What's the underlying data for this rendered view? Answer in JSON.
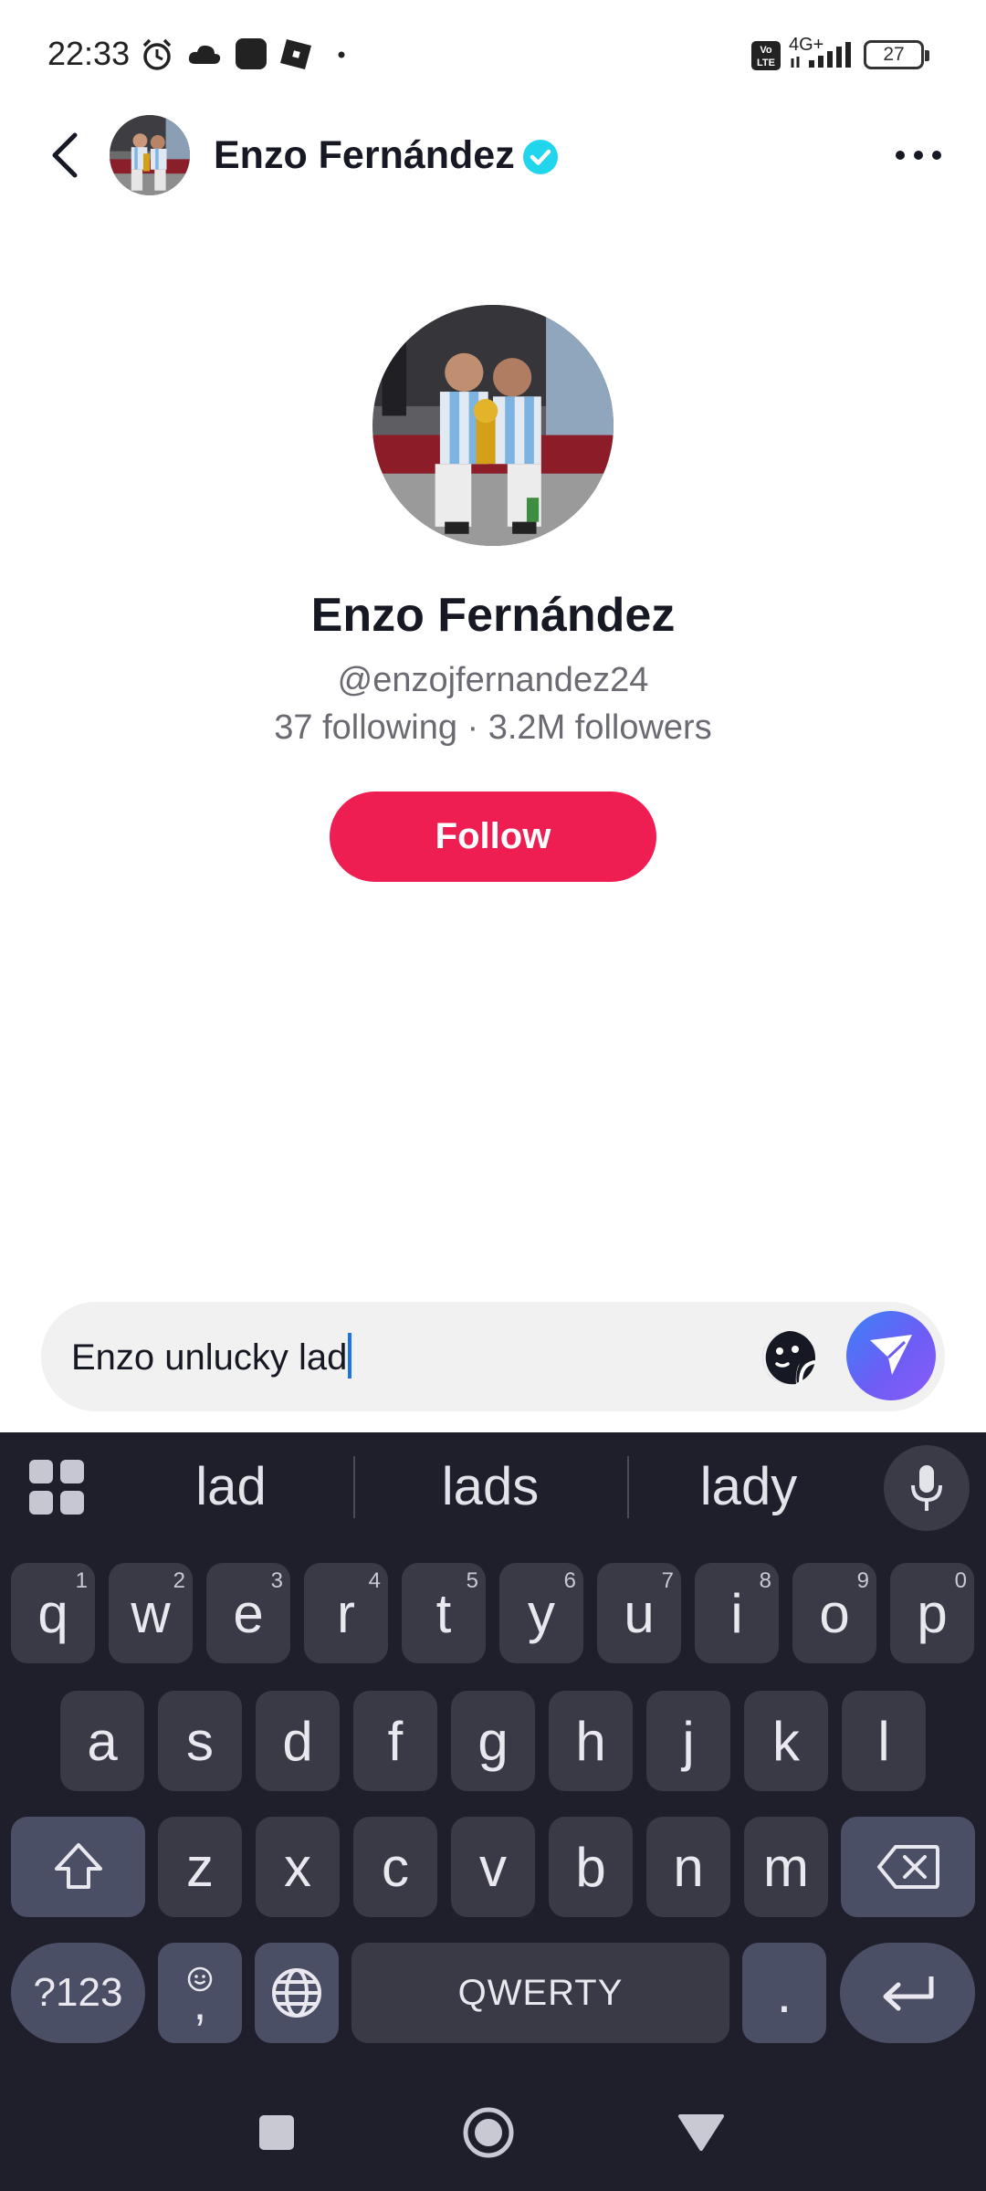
{
  "status_bar": {
    "time": "22:33",
    "network": "4G+",
    "volte": "Vo LTE",
    "battery": "27"
  },
  "header": {
    "name": "Enzo Fernández",
    "back_icon": "chevron-left-icon",
    "more_icon": "more-horizontal-icon",
    "verified_color": "#20d5ec"
  },
  "profile": {
    "name": "Enzo Fernández",
    "handle": "@enzojfernandez24",
    "stats": "37 following · 3.2M followers",
    "follow_label": "Follow",
    "follow_color": "#ee1d52"
  },
  "composer": {
    "text": "Enzo unlucky lad",
    "sticker_icon": "sticker-face-icon",
    "send_icon": "send-icon"
  },
  "keyboard": {
    "suggestions": [
      "lad",
      "lads",
      "lady"
    ],
    "row1": [
      {
        "key": "q",
        "hint": "1"
      },
      {
        "key": "w",
        "hint": "2"
      },
      {
        "key": "e",
        "hint": "3"
      },
      {
        "key": "r",
        "hint": "4"
      },
      {
        "key": "t",
        "hint": "5"
      },
      {
        "key": "y",
        "hint": "6"
      },
      {
        "key": "u",
        "hint": "7"
      },
      {
        "key": "i",
        "hint": "8"
      },
      {
        "key": "o",
        "hint": "9"
      },
      {
        "key": "p",
        "hint": "0"
      }
    ],
    "row2": [
      "a",
      "s",
      "d",
      "f",
      "g",
      "h",
      "j",
      "k",
      "l"
    ],
    "row3": [
      "z",
      "x",
      "c",
      "v",
      "b",
      "n",
      "m"
    ],
    "symbols_label": "?123",
    "comma_label": ",",
    "space_label": "QWERTY",
    "period_label": "."
  }
}
